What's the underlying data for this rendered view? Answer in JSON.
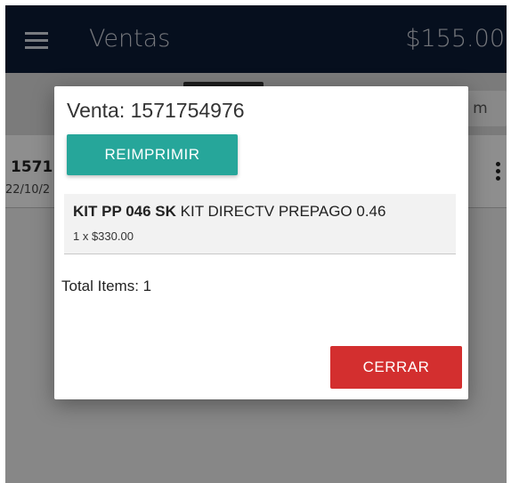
{
  "appbar": {
    "title": "Ventas",
    "total": "$155.00",
    "menu_icon": "hamburger-menu-icon"
  },
  "filter": {
    "right_label": "l m"
  },
  "list": {
    "items": [
      {
        "id": "1571",
        "date": "22/10/2"
      }
    ],
    "more_icon": "more-vert-icon"
  },
  "dialog": {
    "title": "Venta: 1571754976",
    "reprint_label": "REIMPRIMIR",
    "items": [
      {
        "code": "KIT PP 046 SK",
        "description": "KIT DIRECTV PREPAGO 0.46",
        "qty_price": "1 x $330.00"
      }
    ],
    "total_items": "Total Items: 1",
    "close_label": "CERRAR"
  },
  "colors": {
    "appbar_bg": "#0b1a35",
    "reprint_button": "#26a69a",
    "close_button": "#d32f2f"
  }
}
